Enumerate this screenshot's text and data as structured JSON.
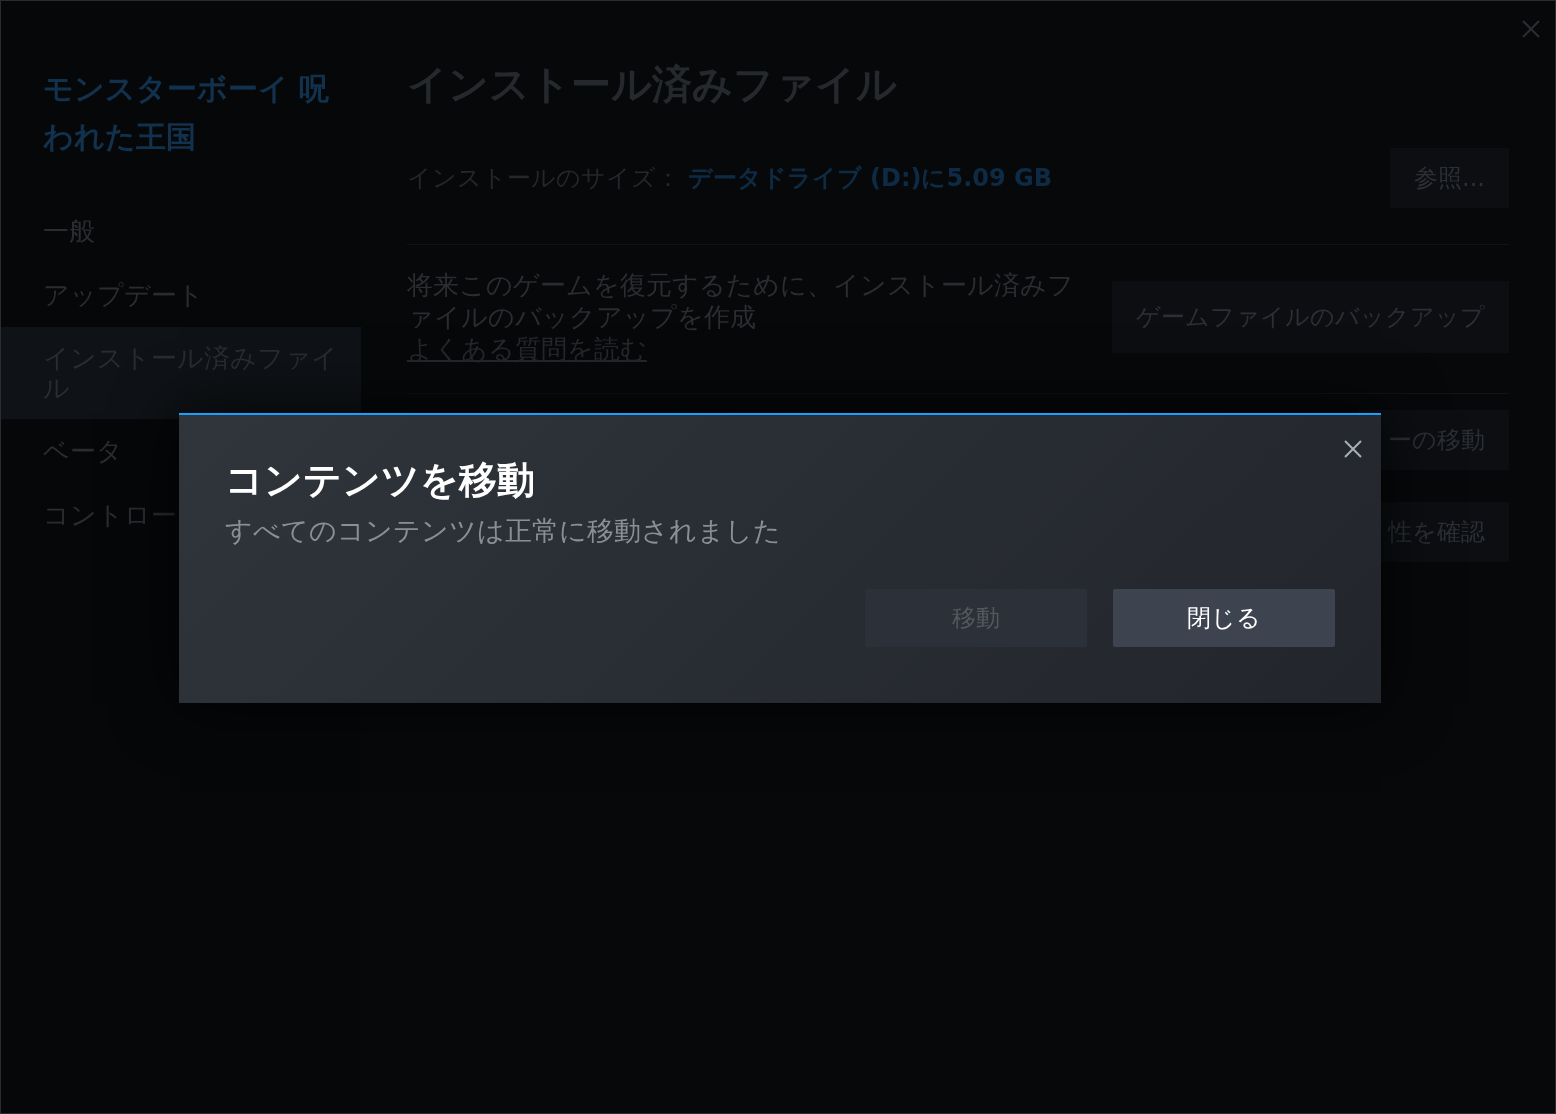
{
  "app_title": "モンスターボーイ 呪われた王国",
  "sidebar": {
    "items": [
      {
        "label": "一般",
        "selected": false
      },
      {
        "label": "アップデート",
        "selected": false
      },
      {
        "label": "インストール済みファイル",
        "selected": true
      },
      {
        "label": "ベータ",
        "selected": false
      },
      {
        "label": "コントロー",
        "selected": false
      }
    ]
  },
  "page": {
    "title": "インストール済みファイル",
    "install_size": {
      "label": "インストールのサイズ：",
      "value": "データドライブ (D:)に5.09 GB"
    },
    "browse_button": "参照...",
    "backup": {
      "description": "将来このゲームを復元するために、インストール済みファイルのバックアップを作成",
      "link": "よくある質問を読む",
      "button": "ゲームファイルのバックアップ"
    },
    "partial_buttons": [
      "ーの移動",
      "性を確認"
    ]
  },
  "dialog": {
    "title": "コンテンツを移動",
    "message": "すべてのコンテンツは正常に移動されました",
    "buttons": [
      {
        "label": "移動",
        "disabled": true
      },
      {
        "label": "閉じる",
        "disabled": false
      }
    ]
  }
}
